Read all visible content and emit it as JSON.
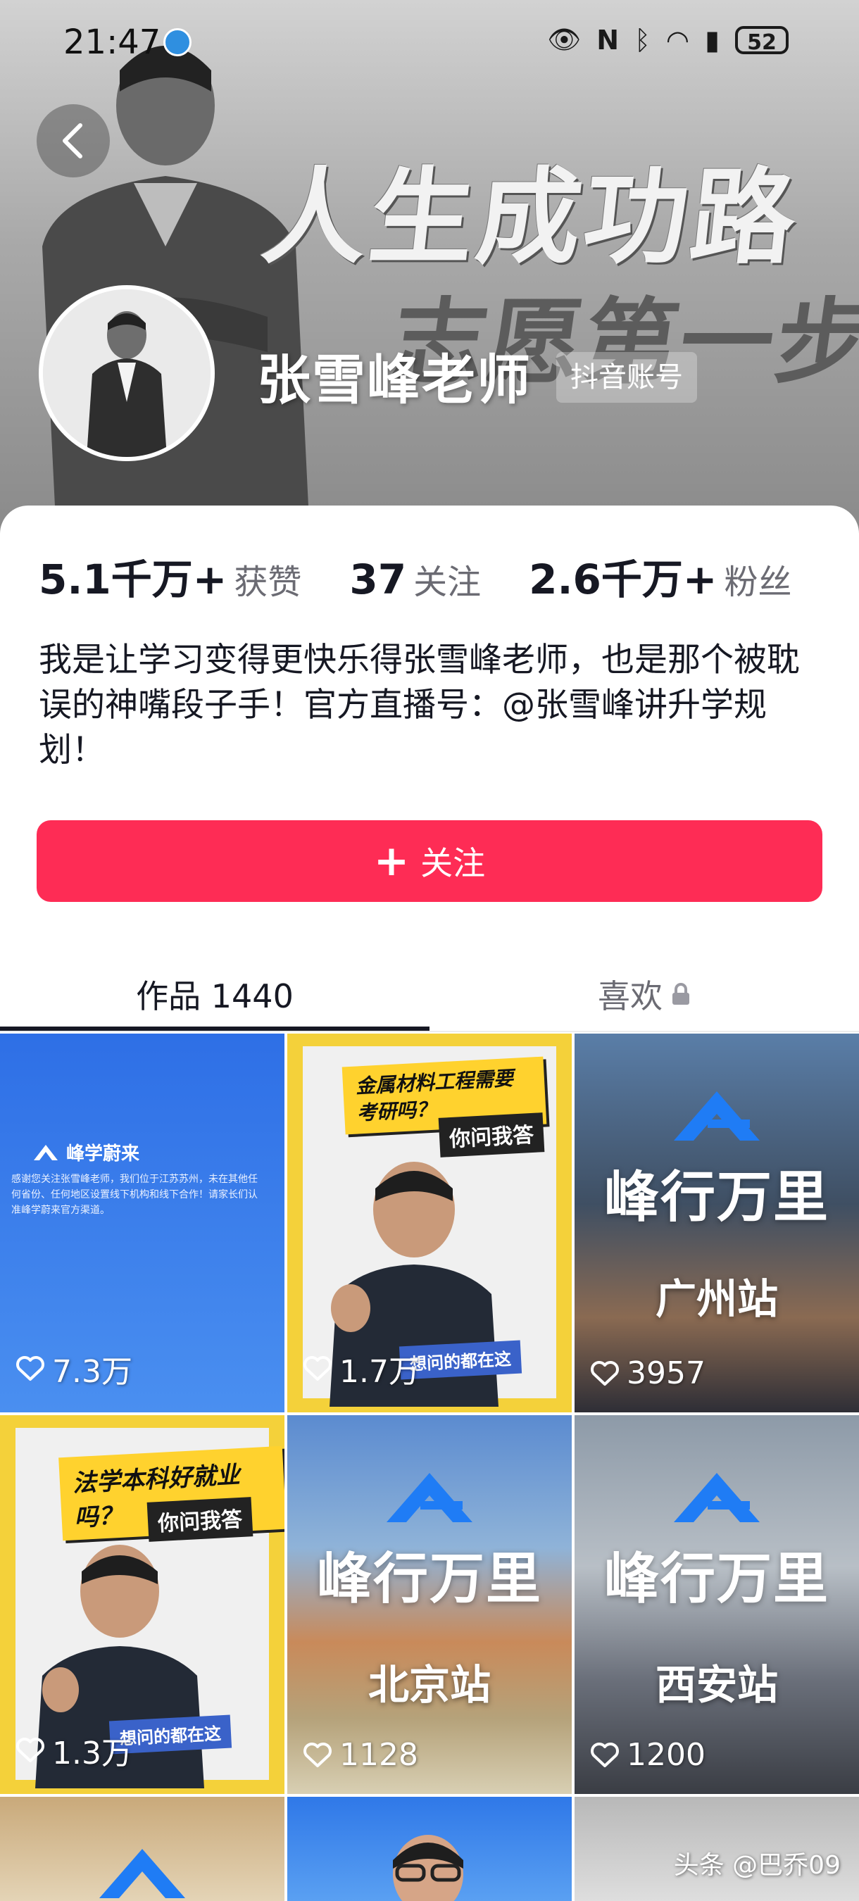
{
  "status_bar": {
    "time": "21:47",
    "battery": "52"
  },
  "banner": {
    "title_line1": "人生成功路",
    "title_line2": "志愿第一步"
  },
  "profile": {
    "name": "张雪峰老师",
    "account_tag": "抖音账号",
    "stats": [
      {
        "value": "5.1千万+",
        "label": "获赞"
      },
      {
        "value": "37",
        "label": "关注"
      },
      {
        "value": "2.6千万+",
        "label": "粉丝"
      }
    ],
    "bio": "我是让学习变得更快乐得张雪峰老师，也是那个被耽误的神嘴段子手！官方直播号：@张雪峰讲升学规划！",
    "follow_label": "关注"
  },
  "tabs": {
    "works": "作品 1440",
    "likes": "喜欢"
  },
  "videos": [
    {
      "likes": "7.3万",
      "brand": "峰学蔚来",
      "notice": "感谢您关注张雪峰老师，我们位于江苏苏州，未在其他任何省份、任何地区设置线下机构和线下合作！请家长们认准峰学蔚来官方渠道。"
    },
    {
      "likes": "1.7万",
      "headline": "金属材料工程需要考研吗？",
      "tag": "你问我答",
      "sticker": "想问的都在这"
    },
    {
      "likes": "3957",
      "brand": "峰行万里",
      "station": "广州站"
    },
    {
      "likes": "1.3万",
      "headline": "法学本科好就业吗？",
      "tag": "你问我答",
      "sticker": "想问的都在这"
    },
    {
      "likes": "1128",
      "brand": "峰行万里",
      "station": "北京站"
    },
    {
      "likes": "1200",
      "brand": "峰行万里",
      "station": "西安站"
    }
  ],
  "watermark": "头条 @巴乔09",
  "colors": {
    "accent": "#fe2c55",
    "text_primary": "#161823",
    "text_secondary": "#6b6b73"
  }
}
